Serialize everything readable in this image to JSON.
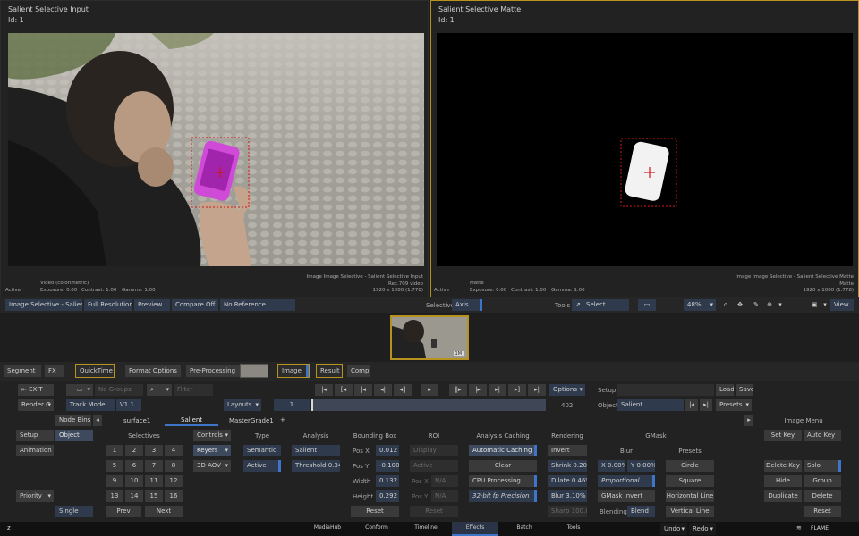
{
  "left_viewer": {
    "title": "Salient Selective Input",
    "id": "Id: 1",
    "colorspace_info": "Video (colorimetric)",
    "active": "Active",
    "exposure": "Exposure: 0.00",
    "contrast": "Contrast: 1.00",
    "gamma": "Gamma: 1.00",
    "info_line1": "Image Image Selective - Salient Selective Input",
    "info_line2": "Rec.709 video",
    "info_line3": "1920 x 1080 (1.778)"
  },
  "right_viewer": {
    "title": "Salient Selective Matte",
    "id": "Id: 1",
    "colorspace_info": "Matte",
    "active": "Active",
    "exposure": "Exposure: 0.00",
    "contrast": "Contrast: 1.00",
    "gamma": "Gamma: 1.00",
    "info_line1": "Image Image Selective - Salient Selective Matte",
    "info_line2": "Matte",
    "info_line3": "1920 x 1080 (1.778)"
  },
  "viewer_bar": {
    "node_name": "Image Selective - Salien",
    "resolution": "Full Resolution",
    "preview": "Preview",
    "compare": "Compare Off",
    "reference": "No Reference",
    "selective_label": "Selective",
    "axis": "Axis",
    "tools_label": "Tools",
    "select_tool": "Select",
    "zoom": "48%",
    "view": "View"
  },
  "thumbnail_badge": "1M",
  "pipeline": {
    "segment": "Segment",
    "fx": "FX",
    "quicktime": "QuickTime",
    "format_options": "Format Options",
    "pre_processing": "Pre-Processing",
    "image": "Image",
    "result": "Result",
    "comp": "Comp"
  },
  "toolbar": {
    "exit": "EXIT",
    "no_groups": "No Groups",
    "filter": "Filter",
    "options": "Options",
    "setup": "Setup",
    "load": "Load",
    "save": "Save",
    "render": "Render C",
    "track_mode": "Track Mode",
    "version": "V1.1",
    "layouts": "Layouts",
    "frame_start": "1",
    "frame_end": "402",
    "object_label": "Object",
    "object_value": "Salient",
    "presets": "Presets",
    "node_bins": "Node Bins",
    "tabs": [
      "surface1",
      "Salient",
      "MasterGrade1"
    ],
    "add_tab": "+"
  },
  "left_col": {
    "setup": "Setup",
    "object": "Object",
    "animation": "Animation",
    "priority": "Priority",
    "single": "Single"
  },
  "selectives": {
    "header": "Selectives",
    "numbers": [
      "1",
      "2",
      "3",
      "4",
      "5",
      "6",
      "7",
      "8",
      "9",
      "10",
      "11",
      "12",
      "13",
      "14",
      "15",
      "16"
    ],
    "prev": "Prev",
    "next": "Next"
  },
  "controls": {
    "header": "Controls",
    "keyers": "Keyers",
    "aov": "3D AOV"
  },
  "type": {
    "header": "Type",
    "semantic": "Semantic",
    "active": "Active"
  },
  "analysis": {
    "header": "Analysis",
    "salient": "Salient",
    "threshold": "Threshold 0.340"
  },
  "bounding_box": {
    "header": "Bounding Box",
    "pos_x_label": "Pos X",
    "pos_x": "0.012",
    "pos_y_label": "Pos Y",
    "pos_y": "-0.100",
    "width_label": "Width",
    "width": "0.132",
    "height_label": "Height",
    "height": "0.292",
    "reset": "Reset"
  },
  "roi": {
    "header": "ROI",
    "display": "Display",
    "active": "Active",
    "pos_x_label": "Pos X",
    "pos_x": "N/A",
    "pos_y_label": "Pos Y",
    "pos_y": "N/A",
    "reset": "Reset"
  },
  "analysis_caching": {
    "header": "Analysis Caching",
    "automatic": "Automatic Caching",
    "clear": "Clear",
    "cpu": "CPU Processing",
    "precision": "32-bit fp Precision"
  },
  "rendering": {
    "header": "Rendering",
    "invert": "Invert",
    "shrink": "Shrink 0.20%",
    "dilate": "Dilate 0.46%",
    "blur": "Blur 3.10%",
    "sharp": "Sharp 100.0"
  },
  "gmask": {
    "header": "GMask",
    "blur_header": "Blur",
    "x": "X 0.00%",
    "y": "Y 0.00%",
    "proportional": "Proportional",
    "gmask_invert": "GMask Invert",
    "blending_label": "Blending",
    "blending": "Blend",
    "presets_header": "Presets",
    "circle": "Circle",
    "square": "Square",
    "horizontal": "Horizontal Line",
    "vertical": "Vertical Line"
  },
  "image_menu": {
    "header": "Image Menu",
    "set_key": "Set Key",
    "auto_key": "Auto Key",
    "delete_key": "Delete Key",
    "solo": "Solo",
    "hide": "Hide",
    "group": "Group",
    "duplicate": "Duplicate",
    "delete": "Delete",
    "reset": "Reset"
  },
  "bottom_bar": {
    "tabs": [
      "MediaHub",
      "Conform",
      "Timeline",
      "Effects",
      "Batch",
      "Tools"
    ],
    "active_tab": "Effects",
    "undo": "Undo",
    "redo": "Redo",
    "app_name": "FLAME",
    "left_glyph": "z"
  },
  "colors": {
    "accent_blue": "#3f75c8",
    "gold": "#b8921f",
    "bbox_red": "#d01818",
    "phone_magenta": "#d04ad8"
  }
}
